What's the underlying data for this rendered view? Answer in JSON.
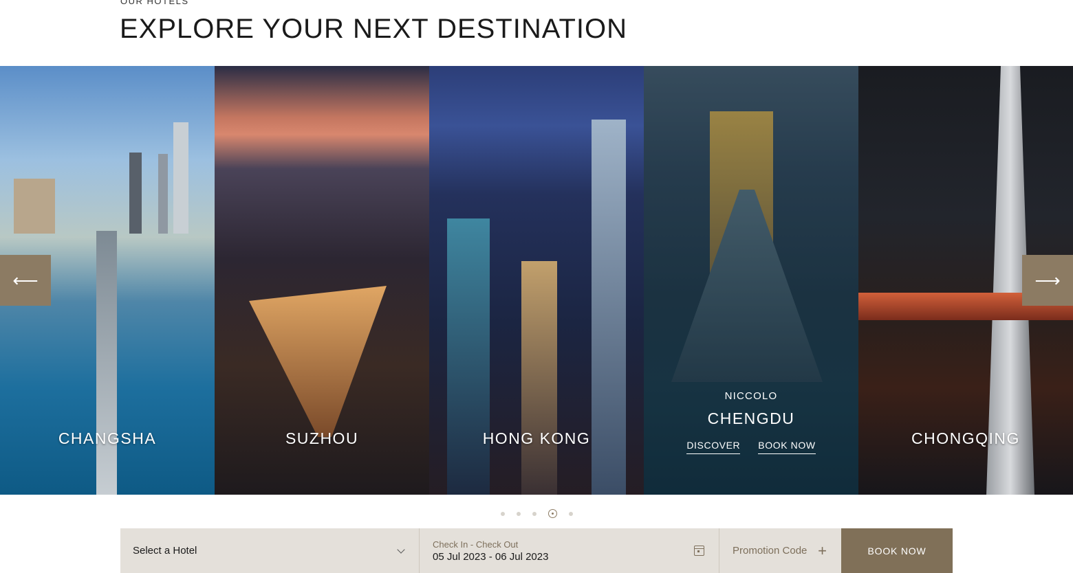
{
  "section": {
    "eyebrow": "OUR HOTELS",
    "headline": "EXPLORE YOUR NEXT DESTINATION"
  },
  "carousel": {
    "prev_icon": "arrow-left-icon",
    "next_icon": "arrow-right-icon",
    "prev_glyph": "⟵",
    "next_glyph": "⟶",
    "panels": [
      {
        "city": "CHANGSHA"
      },
      {
        "city": "SUZHOU"
      },
      {
        "city": "HONG KONG"
      },
      {
        "brand": "NICCOLO",
        "city": "CHENGDU",
        "discover": "DISCOVER",
        "book": "BOOK NOW"
      },
      {
        "city": "CHONGQING"
      }
    ],
    "dots_total": 5,
    "active_dot": 4
  },
  "booking": {
    "hotel_value": "Select a Hotel",
    "dates_label": "Check In - Check Out",
    "dates_value": "05 Jul 2023 - 06 Jul 2023",
    "promo_value": "Promotion Code",
    "plus_glyph": "+",
    "book_label": "BOOK NOW"
  },
  "colors": {
    "accent": "#8c7b63",
    "booking_bg": "#e4e0da",
    "book_button": "#807058"
  }
}
